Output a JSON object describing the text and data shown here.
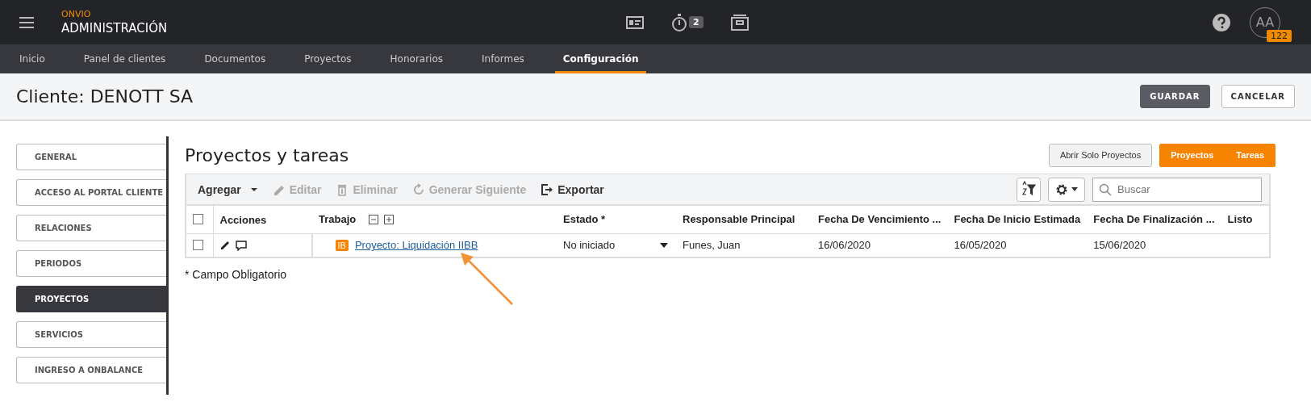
{
  "app": {
    "brand": "ONVIO",
    "title": "ADMINISTRACIÓN",
    "timer_badge": "2",
    "avatar_initials": "AA",
    "avatar_badge": "122"
  },
  "nav_tabs": [
    {
      "label": "Inicio",
      "selected": false
    },
    {
      "label": "Panel de clientes",
      "selected": false
    },
    {
      "label": "Documentos",
      "selected": false
    },
    {
      "label": "Proyectos",
      "selected": false
    },
    {
      "label": "Honorarios",
      "selected": false
    },
    {
      "label": "Informes",
      "selected": false
    },
    {
      "label": "Configuración",
      "selected": true
    }
  ],
  "header": {
    "title": "Cliente: DENOTT SA",
    "buttons": [
      {
        "label": "GUARDAR",
        "kind": "primary"
      },
      {
        "label": "CANCELAR",
        "kind": "secondary"
      }
    ]
  },
  "sidebar": {
    "items": [
      {
        "label": "GENERAL",
        "selected": false
      },
      {
        "label": "ACCESO AL PORTAL CLIENTE",
        "selected": false
      },
      {
        "label": "RELACIONES",
        "selected": false
      },
      {
        "label": "PERIODOS",
        "selected": false
      },
      {
        "label": "PROYECTOS",
        "selected": true
      },
      {
        "label": "SERVICIOS",
        "selected": false
      },
      {
        "label": "INGRESO A ONBALANCE",
        "selected": false
      }
    ]
  },
  "section": {
    "title": "Proyectos y tareas",
    "open_button": "Abrir Solo Proyectos",
    "toggle": [
      "Proyectos",
      "Tareas"
    ]
  },
  "toolbar": {
    "actions": [
      {
        "label": "Agregar",
        "kind": "dropdown",
        "disabled": false
      },
      {
        "label": "Editar",
        "kind": "edit",
        "disabled": true
      },
      {
        "label": "Eliminar",
        "kind": "delete",
        "disabled": true
      },
      {
        "label": "Generar Siguiente",
        "kind": "refresh",
        "disabled": true
      },
      {
        "label": "Exportar",
        "kind": "export",
        "disabled": false
      }
    ],
    "search": {
      "placeholder": "Buscar"
    }
  },
  "table": {
    "select_all_checked": false,
    "columns": [
      "Acciones",
      "Trabajo",
      "Estado *",
      "Responsable Principal",
      "Fecha De Vencimiento ...",
      "Fecha De Inicio Estimada",
      "Fecha De Finalización ...",
      "Listo"
    ],
    "rows": [
      {
        "checked": false,
        "badge": "IB",
        "work": "Proyecto: Liquidación IIBB",
        "status": "No iniciado",
        "owner": "Funes, Juan",
        "due": "16/06/2020",
        "start": "16/05/2020",
        "end": "15/06/2020"
      }
    ]
  },
  "footnote": "* Campo Obligatorio"
}
